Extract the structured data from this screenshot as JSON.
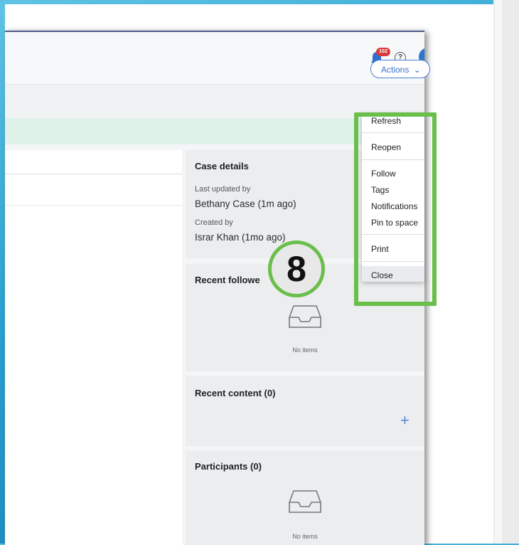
{
  "header": {
    "notification_count": "102",
    "help_glyph": "?"
  },
  "toolbar": {
    "actions_label": "Actions",
    "actions_chevron": "⌄"
  },
  "case_details": {
    "title": "Case details",
    "last_updated_label": "Last updated by",
    "last_updated_value": "Bethany Case (1m ago)",
    "created_label": "Created by",
    "created_value": "Israr Khan (1mo ago)"
  },
  "recent_followers": {
    "title": "Recent followe",
    "empty_text": "No items"
  },
  "recent_content": {
    "title": "Recent content (0)",
    "add_glyph": "+"
  },
  "participants": {
    "title": "Participants (0)",
    "empty_text": "No items"
  },
  "actions_menu": {
    "items": [
      "Refresh",
      "Reopen",
      "Follow",
      "Tags",
      "Notifications",
      "Pin to space",
      "Print",
      "Close"
    ]
  },
  "annotation": {
    "step_number": "8",
    "color": "#6abf4b"
  },
  "colors": {
    "accent": "#3b6fc9",
    "badge": "#d93b3b",
    "banner": "#dff2ea"
  }
}
